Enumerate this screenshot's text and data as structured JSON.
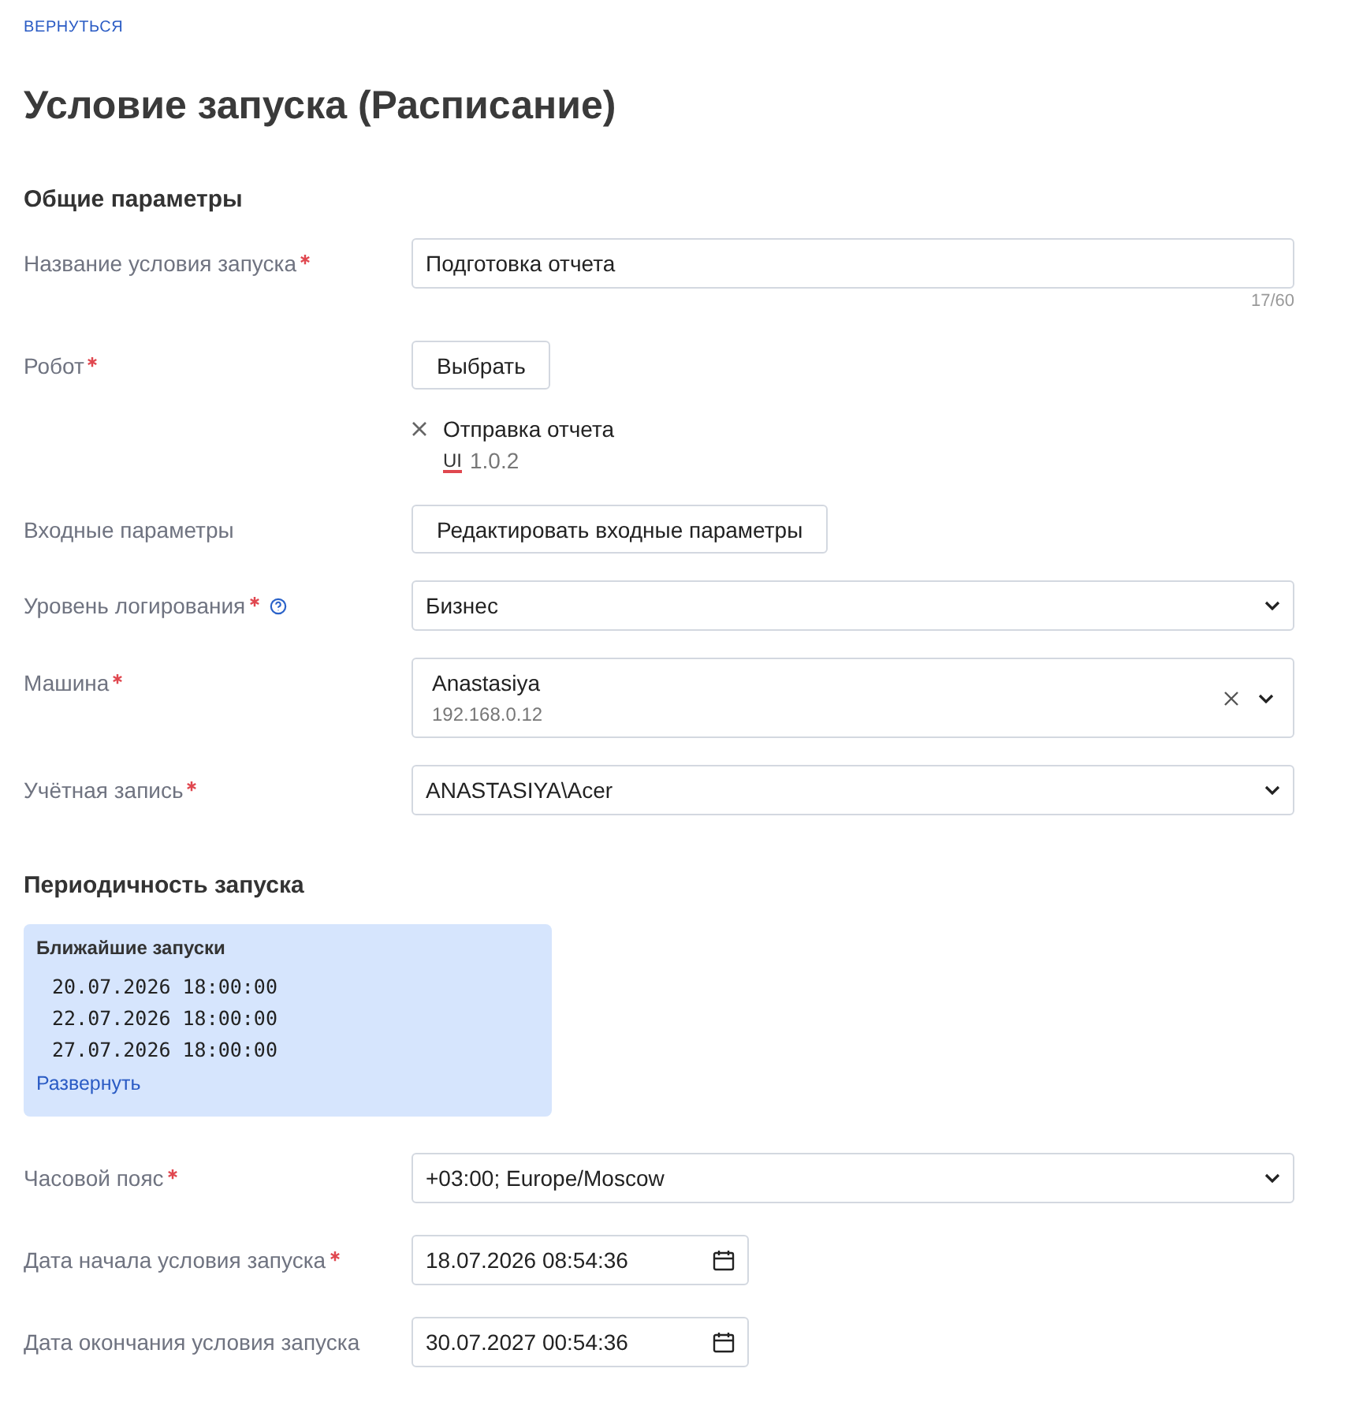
{
  "back_link": "ВЕРНУТЬСЯ",
  "title": "Условие запуска (Расписание)",
  "sections": [
    {
      "heading": "Общие параметры",
      "rows": [
        {
          "kind": "text",
          "label": "Название условия запуска",
          "required": true,
          "value": "Подготовка отчета",
          "counter": "17/60"
        },
        {
          "kind": "robot",
          "label": "Робот",
          "required": true,
          "button": "Выбрать",
          "robot_name": "Отправка отчета",
          "robot_type": "UI",
          "robot_version": "1.0.2"
        },
        {
          "kind": "button",
          "label": "Входные параметры",
          "required": false,
          "button": "Редактировать входные параметры"
        },
        {
          "kind": "select",
          "label": "Уровень логирования",
          "required": true,
          "help": true,
          "value": "Бизнес"
        },
        {
          "kind": "machine",
          "label": "Машина",
          "required": true,
          "value": "Anastasiya",
          "sub": "192.168.0.12"
        },
        {
          "kind": "select",
          "label": "Учётная запись",
          "required": true,
          "value": "ANASTASIYA\\Acer"
        }
      ]
    },
    {
      "heading": "Периодичность запуска",
      "upcoming": {
        "title": "Ближайшие запуски",
        "times": [
          "20.07.2026 18:00:00",
          "22.07.2026 18:00:00",
          "27.07.2026 18:00:00"
        ],
        "link": "Развернуть"
      },
      "rows": [
        {
          "kind": "select",
          "label": "Часовой пояс",
          "required": true,
          "value": "+03:00; Europe/Moscow"
        },
        {
          "kind": "date",
          "label": "Дата начала условия запуска",
          "required": true,
          "value": "18.07.2026 08:54:36"
        },
        {
          "kind": "date",
          "label": "Дата окончания условия запуска",
          "required": false,
          "value": "30.07.2027 00:54:36"
        }
      ]
    }
  ]
}
